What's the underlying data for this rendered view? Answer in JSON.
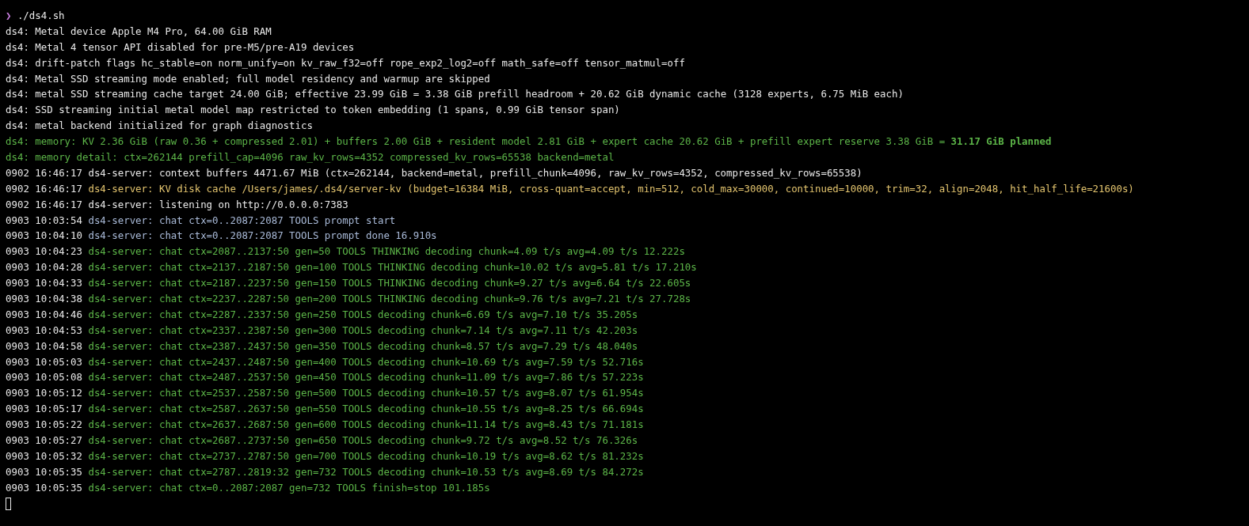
{
  "prompt": {
    "symbol": "❯",
    "command": "./ds4.sh"
  },
  "lines": [
    {
      "text": "ds4: Metal device Apple M4 Pro, 64.00 GiB RAM",
      "color": "#e8e8e8"
    },
    {
      "text": "ds4: Metal 4 tensor API disabled for pre-M5/pre-A19 devices",
      "color": "#e8e8e8"
    },
    {
      "text": "ds4: drift-patch flags hc_stable=on norm_unify=on kv_raw_f32=off rope_exp2_log2=off math_safe=off tensor_matmul=off",
      "color": "#e8e8e8"
    },
    {
      "text": "ds4: Metal SSD streaming mode enabled; full model residency and warmup are skipped",
      "color": "#e8e8e8"
    },
    {
      "text": "ds4: metal SSD streaming cache target 24.00 GiB; effective 23.99 GiB = 3.38 GiB prefill headroom + 20.62 GiB dynamic cache (3128 experts, 6.75 MiB each)",
      "color": "#e8e8e8"
    },
    {
      "text": "ds4: SSD streaming initial metal model map restricted to token embedding (1 spans, 0.99 GiB tensor span)",
      "color": "#e8e8e8"
    },
    {
      "text": "ds4: metal backend initialized for graph diagnostics",
      "color": "#e8e8e8"
    },
    {
      "text": "ds4: memory: KV 2.36 GiB (raw 0.36 + compressed 2.01) + buffers 2.00 GiB + resident model 2.81 GiB + expert cache 20.62 GiB + prefill expert reserve 3.38 GiB = **31.17 GiB planned**",
      "color": "#5cb548"
    },
    {
      "text": "ds4: memory detail: ctx=262144 prefill_cap=4096 raw_kv_rows=4352 compressed_kv_rows=65538 backend=metal",
      "color": "#5cb548"
    },
    {
      "time": "0902 16:46:17",
      "text": "ds4-server: context buffers 4471.67 MiB (ctx=262144, backend=metal, prefill_chunk=4096, raw_kv_rows=4352, compressed_kv_rows=65538)",
      "color": "#e8e8e8"
    },
    {
      "time": "0902 16:46:17",
      "text": "ds4-server: KV disk cache /Users/james/.ds4/server-kv (budget=16384 MiB, cross-quant=accept, min=512, cold_max=30000, continued=10000, trim=32, align=2048, hit_half_life=21600s)",
      "color": "#e3c46e"
    },
    {
      "time": "0902 16:46:17",
      "text": "ds4-server: listening on http://0.0.0.0:7383",
      "color": "#e8e8e8"
    },
    {
      "time": "0903 10:03:54",
      "text": "ds4-server: chat ctx=0..2087:2087 TOOLS prompt start",
      "color": "#a9bad8"
    },
    {
      "time": "0903 10:04:10",
      "text": "ds4-server: chat ctx=0..2087:2087 TOOLS prompt done 16.910s",
      "color": "#a9bad8"
    },
    {
      "time": "0903 10:04:23",
      "text": "ds4-server: chat ctx=2087..2137:50 gen=50 TOOLS THINKING decoding chunk=4.09 t/s avg=4.09 t/s 12.222s",
      "color": "#5cb548"
    },
    {
      "time": "0903 10:04:28",
      "text": "ds4-server: chat ctx=2137..2187:50 gen=100 TOOLS THINKING decoding chunk=10.02 t/s avg=5.81 t/s 17.210s",
      "color": "#5cb548"
    },
    {
      "time": "0903 10:04:33",
      "text": "ds4-server: chat ctx=2187..2237:50 gen=150 TOOLS THINKING decoding chunk=9.27 t/s avg=6.64 t/s 22.605s",
      "color": "#5cb548"
    },
    {
      "time": "0903 10:04:38",
      "text": "ds4-server: chat ctx=2237..2287:50 gen=200 TOOLS THINKING decoding chunk=9.76 t/s avg=7.21 t/s 27.728s",
      "color": "#5cb548"
    },
    {
      "time": "0903 10:04:46",
      "text": "ds4-server: chat ctx=2287..2337:50 gen=250 TOOLS decoding chunk=6.69 t/s avg=7.10 t/s 35.205s",
      "color": "#5cb548"
    },
    {
      "time": "0903 10:04:53",
      "text": "ds4-server: chat ctx=2337..2387:50 gen=300 TOOLS decoding chunk=7.14 t/s avg=7.11 t/s 42.203s",
      "color": "#5cb548"
    },
    {
      "time": "0903 10:04:58",
      "text": "ds4-server: chat ctx=2387..2437:50 gen=350 TOOLS decoding chunk=8.57 t/s avg=7.29 t/s 48.040s",
      "color": "#5cb548"
    },
    {
      "time": "0903 10:05:03",
      "text": "ds4-server: chat ctx=2437..2487:50 gen=400 TOOLS decoding chunk=10.69 t/s avg=7.59 t/s 52.716s",
      "color": "#5cb548"
    },
    {
      "time": "0903 10:05:08",
      "text": "ds4-server: chat ctx=2487..2537:50 gen=450 TOOLS decoding chunk=11.09 t/s avg=7.86 t/s 57.223s",
      "color": "#5cb548"
    },
    {
      "time": "0903 10:05:12",
      "text": "ds4-server: chat ctx=2537..2587:50 gen=500 TOOLS decoding chunk=10.57 t/s avg=8.07 t/s 61.954s",
      "color": "#5cb548"
    },
    {
      "time": "0903 10:05:17",
      "text": "ds4-server: chat ctx=2587..2637:50 gen=550 TOOLS decoding chunk=10.55 t/s avg=8.25 t/s 66.694s",
      "color": "#5cb548"
    },
    {
      "time": "0903 10:05:22",
      "text": "ds4-server: chat ctx=2637..2687:50 gen=600 TOOLS decoding chunk=11.14 t/s avg=8.43 t/s 71.181s",
      "color": "#5cb548"
    },
    {
      "time": "0903 10:05:27",
      "text": "ds4-server: chat ctx=2687..2737:50 gen=650 TOOLS decoding chunk=9.72 t/s avg=8.52 t/s 76.326s",
      "color": "#5cb548"
    },
    {
      "time": "0903 10:05:32",
      "text": "ds4-server: chat ctx=2737..2787:50 gen=700 TOOLS decoding chunk=10.19 t/s avg=8.62 t/s 81.232s",
      "color": "#5cb548"
    },
    {
      "time": "0903 10:05:35",
      "text": "ds4-server: chat ctx=2787..2819:32 gen=732 TOOLS decoding chunk=10.53 t/s avg=8.69 t/s 84.272s",
      "color": "#5cb548"
    },
    {
      "time": "0903 10:05:35",
      "text": "ds4-server: chat ctx=0..2087:2087 gen=732 TOOLS finish=stop 101.185s",
      "color": "#5cb548"
    }
  ]
}
